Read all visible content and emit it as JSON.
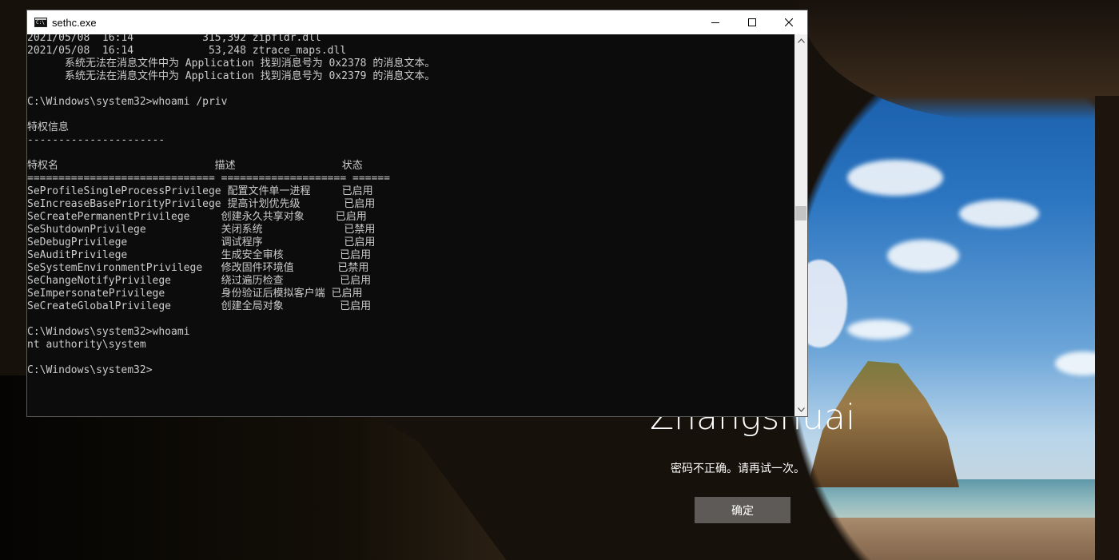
{
  "console": {
    "title": "sethc.exe",
    "lines": [
      "2021/05/08  16:14           315,392 zipfldr.dll",
      "2021/05/08  16:14            53,248 ztrace_maps.dll",
      "      系统无法在消息文件中为 Application 找到消息号为 0x2378 的消息文本。",
      "      系统无法在消息文件中为 Application 找到消息号为 0x2379 的消息文本。",
      "",
      "C:\\Windows\\system32>whoami /priv",
      "",
      "特权信息",
      "----------------------",
      "",
      "特权名                         描述                 状态",
      "============================== ==================== ======",
      "SeProfileSingleProcessPrivilege 配置文件单一进程     已启用",
      "SeIncreaseBasePriorityPrivilege 提高计划优先级       已启用",
      "SeCreatePermanentPrivilege     创建永久共享对象     已启用",
      "SeShutdownPrivilege            关闭系统             已禁用",
      "SeDebugPrivilege               调试程序             已启用",
      "SeAuditPrivilege               生成安全审核         已启用",
      "SeSystemEnvironmentPrivilege   修改固件环境值       已禁用",
      "SeChangeNotifyPrivilege        绕过遍历检查         已启用",
      "SeImpersonatePrivilege         身份验证后模拟客户端 已启用",
      "SeCreateGlobalPrivilege        创建全局对象         已启用",
      "",
      "C:\\Windows\\system32>whoami",
      "nt authority\\system",
      "",
      "C:\\Windows\\system32>"
    ]
  },
  "lockscreen": {
    "username": "Zhangshuai",
    "message": "密码不正确。请再试一次。",
    "ok_label": "确定"
  },
  "icons": {
    "app": "console-icon",
    "minimize": "minimize-icon",
    "maximize": "maximize-icon",
    "close": "close-icon",
    "scroll_up": "arrow-up-icon",
    "scroll_down": "arrow-down-icon"
  }
}
